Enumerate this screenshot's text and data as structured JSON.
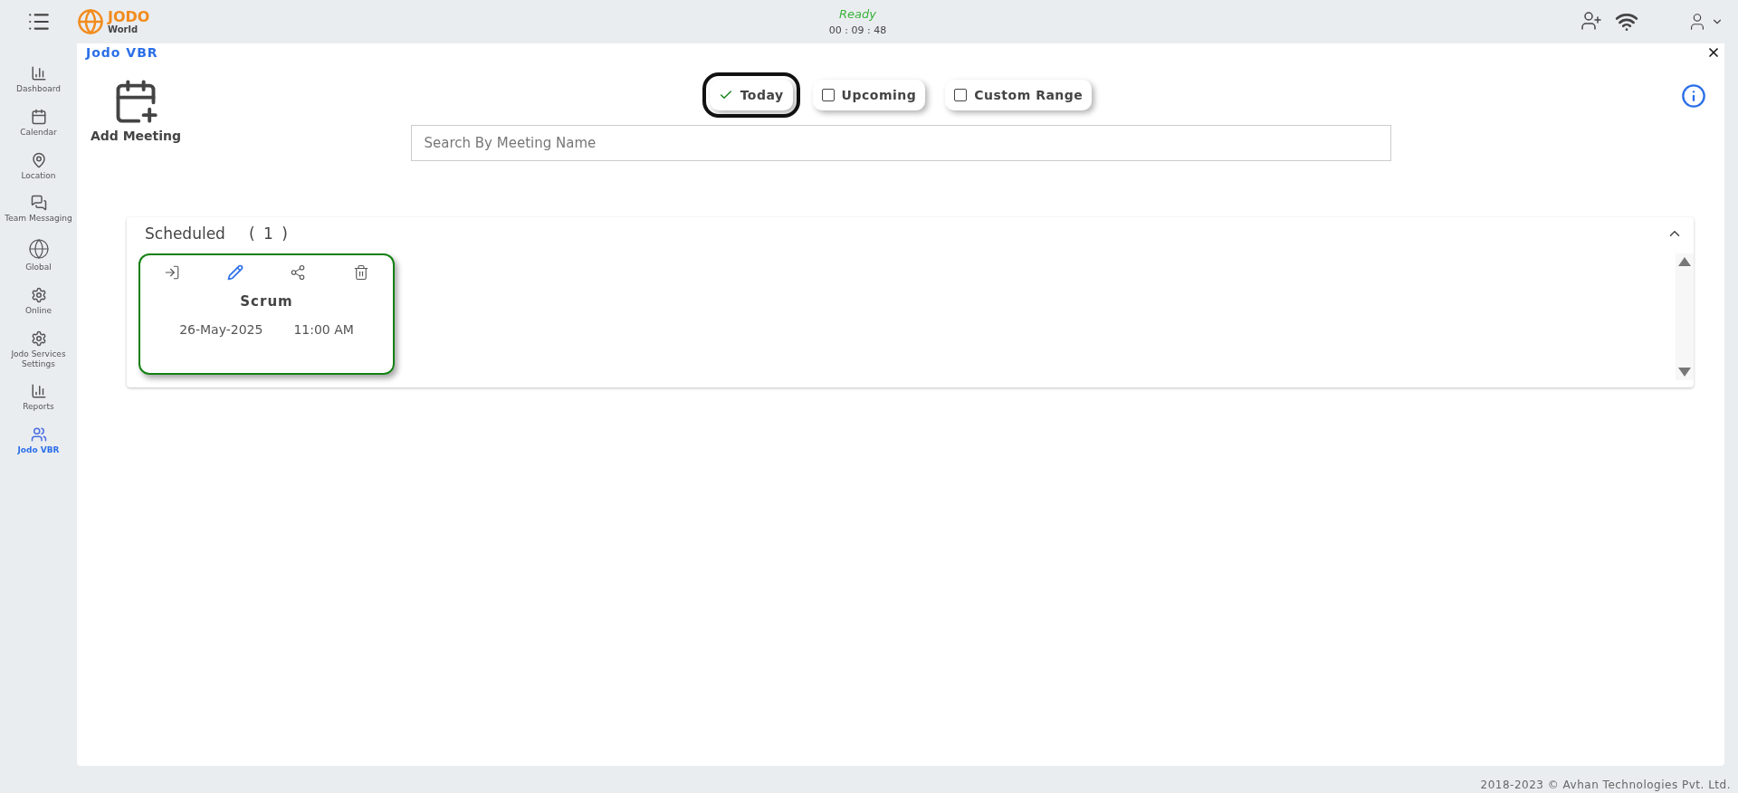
{
  "topbar": {
    "logo_title": "JODO",
    "logo_subtitle": "World",
    "status": "Ready",
    "timer": "00 : 09 : 48"
  },
  "sidebar": {
    "items": [
      {
        "label": "Dashboard",
        "selected": false
      },
      {
        "label": "Calendar",
        "selected": false
      },
      {
        "label": "Location",
        "selected": false
      },
      {
        "label": "Team Messaging",
        "selected": false
      },
      {
        "label": "Global",
        "selected": false
      },
      {
        "label": "Online",
        "selected": false
      },
      {
        "label": "Jodo Services Settings",
        "selected": false
      },
      {
        "label": "Reports",
        "selected": false
      },
      {
        "label": "Jodo VBR",
        "selected": true
      }
    ]
  },
  "panel": {
    "title": "Jodo VBR",
    "add_meeting": "Add Meeting",
    "filters": [
      {
        "label": "Today",
        "selected": true
      },
      {
        "label": "Upcoming",
        "selected": false
      },
      {
        "label": "Custom Range",
        "selected": false
      }
    ],
    "search": {
      "placeholder": "Search By Meeting Name"
    },
    "section": {
      "title": "Scheduled",
      "count": "( 1 )",
      "expanded": true,
      "meetings": [
        {
          "name": "Scrum",
          "date": "26-May-2025",
          "time": "11:00 AM"
        }
      ]
    }
  },
  "footer": "2018-2023 © Avhan Technologies Pvt. Ltd."
}
